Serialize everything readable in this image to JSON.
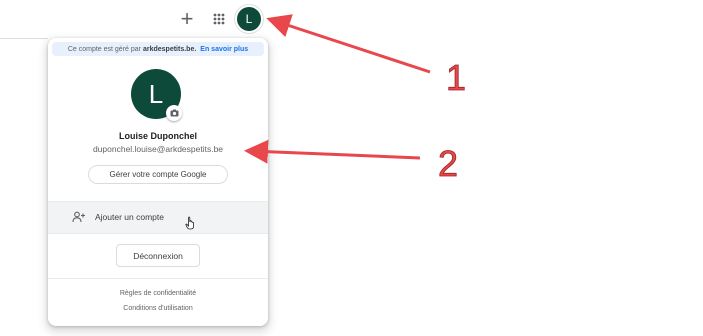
{
  "header": {
    "plus_symbol": "+",
    "avatar_initial": "L"
  },
  "account_menu": {
    "managed_prefix": "Ce compte est géré par",
    "managed_domain": "arkdespetits.be.",
    "learn_more": "En savoir plus",
    "avatar_initial": "L",
    "user_name": "Louise Duponchel",
    "user_email": "duponchel.louise@arkdespetits.be",
    "manage_account": "Gérer votre compte Google",
    "add_account": "Ajouter un compte",
    "logout": "Déconnexion",
    "privacy": "Règles de confidentialité",
    "terms": "Conditions d'utilisation"
  },
  "annotations": {
    "label_1": "1",
    "label_2": "2"
  },
  "colors": {
    "avatar_bg": "#0d4a3a",
    "link_blue": "#1a73e8",
    "managed_bg": "#e8f0fe",
    "arrow_red": "#e8474c"
  },
  "icons": [
    "plus-icon",
    "apps-grid-icon",
    "camera-icon",
    "add-person-icon",
    "hand-cursor-icon"
  ]
}
